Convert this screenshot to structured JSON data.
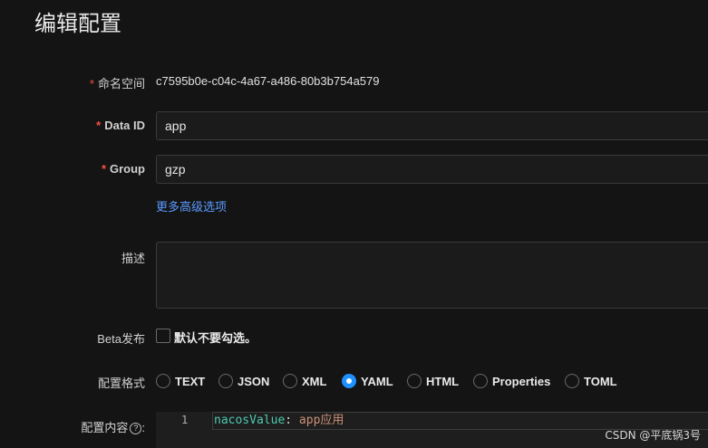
{
  "page": {
    "title": "编辑配置"
  },
  "form": {
    "namespace": {
      "label": "命名空间",
      "required_mark": "*",
      "value": "c7595b0e-c04c-4a67-a486-80b3b754a579"
    },
    "data_id": {
      "label": "Data ID",
      "required_mark": "*",
      "value": "app"
    },
    "group": {
      "label": "Group",
      "required_mark": "*",
      "value": "gzp"
    },
    "more_options_link": "更多高级选项",
    "description": {
      "label": "描述",
      "value": ""
    },
    "beta": {
      "label": "Beta发布",
      "checkbox_label": "默认不要勾选。",
      "checked": false
    },
    "format": {
      "label": "配置格式",
      "options": [
        "TEXT",
        "JSON",
        "XML",
        "YAML",
        "HTML",
        "Properties",
        "TOML"
      ],
      "selected": "YAML"
    },
    "content": {
      "label": "配置内容",
      "help_icon": "?",
      "colon": ":",
      "lines": [
        {
          "number": "1",
          "key": "nacosValue",
          "separator": ":",
          "value": " app应用"
        }
      ]
    }
  },
  "watermark": "CSDN @平底锅3号",
  "colors": {
    "accent": "#1e90ff",
    "required": "#f5503f",
    "link": "#5b9bff",
    "background": "#141414"
  }
}
